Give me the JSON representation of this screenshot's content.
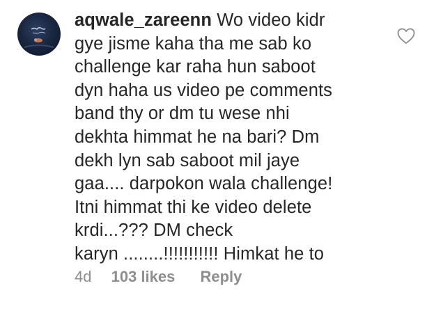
{
  "comment": {
    "username": "aqwale_zareenn",
    "text_lines": [
      "Wo video kidr",
      "gye jisme kaha tha me sab ko",
      "challenge kar raha hun saboot",
      "dyn haha us video pe comments",
      "band thy or dm tu wese nhi",
      "dekhta himmat he na bari? Dm",
      "dekh lyn sab saboot mil jaye",
      "gaa.... darpokon wala challenge!",
      "Itni himmat thi ke video delete",
      "krdi...??? DM check",
      "karyn ........!!!!!!!!!!! Himkat he to"
    ],
    "age": "4d",
    "likes": "103 likes",
    "reply_label": "Reply"
  },
  "icons": {
    "avatar": "profile-avatar",
    "like": "heart-outline-icon"
  },
  "colors": {
    "text": "#262626",
    "meta": "#8e8e8e",
    "background": "#ffffff"
  }
}
